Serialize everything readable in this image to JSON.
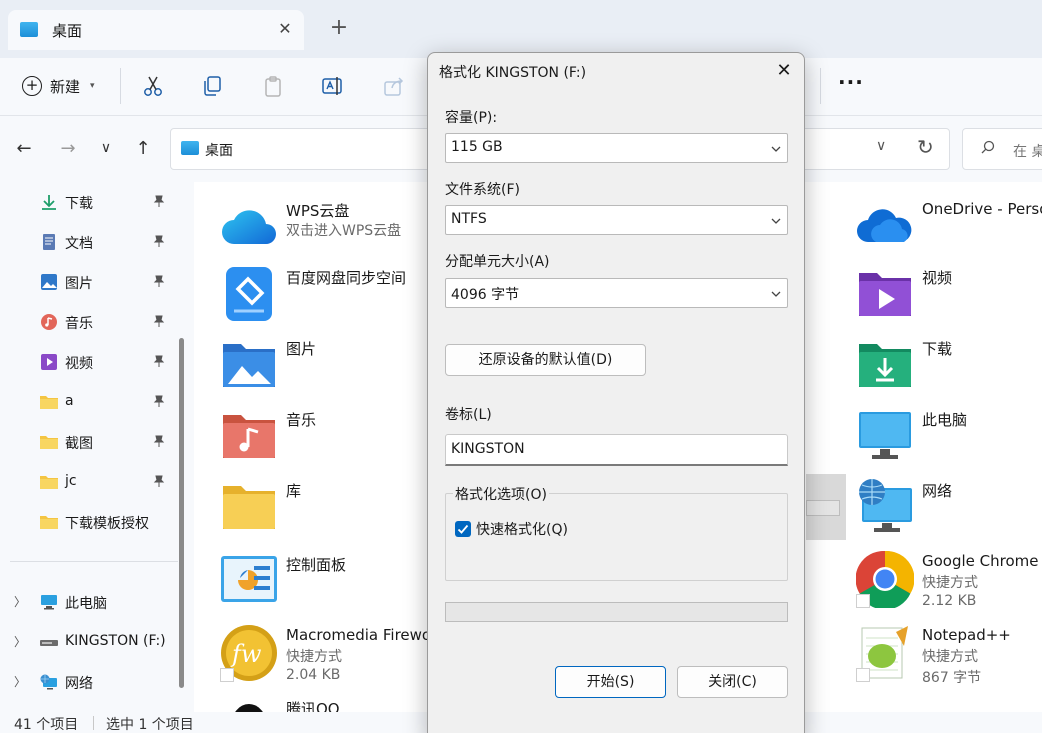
{
  "explorer": {
    "tab_title": "桌面",
    "tab_close": "✕",
    "tab_add": "+",
    "new_label": "新建",
    "more": "···",
    "address": "桌面",
    "search_placeholder": "在 桌",
    "sidebar": {
      "quick_access": [
        {
          "label": "下载",
          "icon": "download-icon"
        },
        {
          "label": "文档",
          "icon": "document-icon"
        },
        {
          "label": "图片",
          "icon": "pictures-icon"
        },
        {
          "label": "音乐",
          "icon": "music-icon"
        },
        {
          "label": "视频",
          "icon": "video-icon"
        },
        {
          "label": "a",
          "icon": "folder-icon"
        },
        {
          "label": "截图",
          "icon": "folder-icon"
        },
        {
          "label": "jc",
          "icon": "folder-icon"
        },
        {
          "label": "下载模板授权",
          "icon": "folder-icon"
        }
      ],
      "tree": [
        {
          "label": "此电脑",
          "icon": "this-pc-icon"
        },
        {
          "label": "KINGSTON (F:)",
          "icon": "drive-icon"
        },
        {
          "label": "网络",
          "icon": "network-icon"
        }
      ]
    },
    "files_left": [
      {
        "name": "WPS云盘",
        "sub": "双击进入WPS云盘",
        "icon": "wps-cloud-icon"
      },
      {
        "name": "百度网盘同步空间",
        "icon": "baidu-netdisk-icon"
      },
      {
        "name": "图片",
        "icon": "pictures-folder-icon"
      },
      {
        "name": "音乐",
        "icon": "music-folder-icon"
      },
      {
        "name": "库",
        "icon": "library-folder-icon"
      },
      {
        "name": "控制面板",
        "icon": "control-panel-icon"
      },
      {
        "name": "Macromedia Firewo",
        "sub": "快捷方式",
        "sub2": "2.04 KB",
        "icon": "fireworks-icon"
      },
      {
        "name": "腾讯QQ",
        "icon": "qq-icon"
      }
    ],
    "files_right": [
      {
        "name": "OneDrive - Perso",
        "icon": "onedrive-icon"
      },
      {
        "name": "视频",
        "icon": "videos-folder-icon"
      },
      {
        "name": "下载",
        "icon": "downloads-folder-icon"
      },
      {
        "name": "此电脑",
        "icon": "this-pc-icon"
      },
      {
        "name": "网络",
        "icon": "network-icon"
      },
      {
        "name": "Google Chrome",
        "sub": "快捷方式",
        "sub2": "2.12 KB",
        "icon": "chrome-icon"
      },
      {
        "name": "Notepad++",
        "sub": "快捷方式",
        "sub2": "867 字节",
        "icon": "notepad-plus-plus-icon"
      }
    ],
    "status": {
      "count": "41 个项目",
      "selected": "选中 1 个项目"
    }
  },
  "dialog": {
    "title": "格式化 KINGSTON (F:)",
    "close": "✕",
    "capacity_label": "容量(P):",
    "capacity_value": "115 GB",
    "filesystem_label": "文件系统(F)",
    "filesystem_value": "NTFS",
    "alloc_label": "分配单元大小(A)",
    "alloc_value": "4096 字节",
    "restore_button": "还原设备的默认值(D)",
    "volume_label": "卷标(L)",
    "volume_value": "KINGSTON",
    "options_label": "格式化选项(O)",
    "quick_format_label": "快速格式化(Q)",
    "quick_format_checked": true,
    "progress": 0,
    "start_button": "开始(S)",
    "close_button": "关闭(C)"
  },
  "colors": {
    "accent": "#0067c0",
    "folder": "#f4c542"
  }
}
